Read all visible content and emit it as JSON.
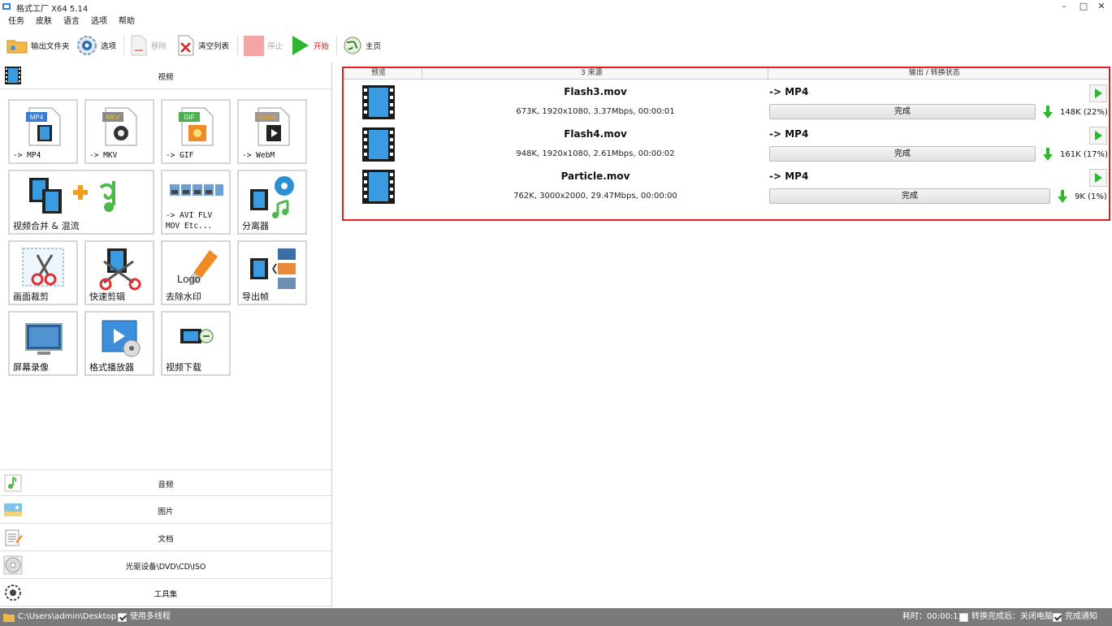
{
  "window": {
    "title": "格式工厂 X64 5.14",
    "minimize_glyph": "–",
    "maximize_glyph": "□",
    "close_glyph": "✕"
  },
  "menu": [
    "任务",
    "皮肤",
    "语言",
    "选项",
    "帮助"
  ],
  "toolbar": {
    "output_folder": "输出文件夹",
    "options": "选项",
    "remove": "移除",
    "clear_list": "清空列表",
    "stop": "停止",
    "start": "开始",
    "home": "主页"
  },
  "left_panel": {
    "video_header": "视频",
    "tiles": [
      {
        "label": "-> MP4",
        "badge": "MP4"
      },
      {
        "label": "-> MKV",
        "badge": "MKV"
      },
      {
        "label": "-> GIF",
        "badge": "GIF"
      },
      {
        "label": "-> WebM",
        "badge": "WebM"
      },
      {
        "label": "视频合并 & 混流"
      },
      {
        "label": "-> AVI FLV\nMOV Etc..."
      },
      {
        "label": "分离器"
      },
      {
        "label": "画面裁剪"
      },
      {
        "label": "快速剪辑"
      },
      {
        "label": "去除水印",
        "logo_text": "Logo"
      },
      {
        "label": "导出帧"
      },
      {
        "label": "屏幕录像"
      },
      {
        "label": "格式播放器"
      },
      {
        "label": "视频下载"
      }
    ],
    "categories": [
      "音频",
      "图片",
      "文档",
      "光驱设备\\DVD\\CD\\ISO",
      "工具集"
    ]
  },
  "file_list": {
    "columns": {
      "preview": "预览",
      "source": "3 来源",
      "output": "输出 / 转换状态"
    },
    "rows": [
      {
        "name": "Flash3.mov",
        "meta": "673K, 1920x1080, 3.37Mbps, 00:00:01",
        "target": "-> MP4",
        "status": "完成",
        "progress": 1.0,
        "size": "148K  (22%)"
      },
      {
        "name": "Flash4.mov",
        "meta": "948K, 1920x1080, 2.61Mbps, 00:00:02",
        "target": "-> MP4",
        "status": "完成",
        "progress": 1.0,
        "size": "161K  (17%)"
      },
      {
        "name": "Particle.mov",
        "meta": "762K, 3000x2000, 29.47Mbps, 00:00:00",
        "target": "-> MP4",
        "status": "完成",
        "progress": 1.0,
        "size": "9K  (1%)"
      }
    ]
  },
  "statusbar": {
    "path": "C:\\Users\\admin\\Desktop",
    "multithread": "使用多线程",
    "elapsed": "耗时：00:00:13",
    "after_convert": "转换完成后：关闭电脑",
    "notify": "完成通知"
  },
  "colors": {
    "accent_red": "#e02020",
    "play_green": "#2fb52f",
    "statusbar": "#7a7a7a"
  }
}
